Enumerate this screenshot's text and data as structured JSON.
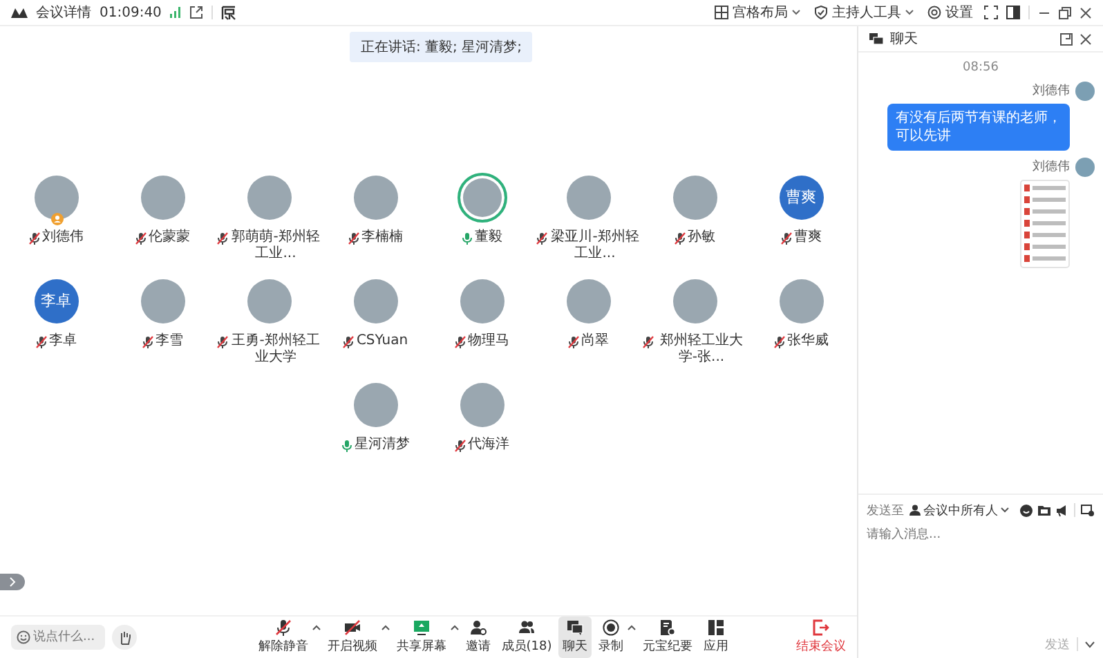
{
  "top_bar": {
    "title": "会议详情",
    "duration": "01:09:40",
    "menus": [
      {
        "label": "宫格布局",
        "kind": "grid"
      },
      {
        "label": "主持人工具",
        "kind": "host"
      },
      {
        "label": "设置",
        "kind": "settings"
      }
    ]
  },
  "speaking_banner": "正在讲话: 董毅; 星河清梦;",
  "participants": [
    {
      "name": "刘德伟",
      "kind": "photo",
      "muted": true,
      "host": true,
      "speaking": false
    },
    {
      "name": "伦蒙蒙",
      "kind": "photo",
      "muted": true,
      "host": false,
      "speaking": false
    },
    {
      "name": "郭萌萌-郑州轻工业...",
      "kind": "photo",
      "muted": true,
      "host": false,
      "speaking": false
    },
    {
      "name": "李楠楠",
      "kind": "photo",
      "muted": true,
      "host": false,
      "speaking": false
    },
    {
      "name": "董毅",
      "kind": "photo",
      "muted": false,
      "host": false,
      "speaking": true
    },
    {
      "name": "梁亚川-郑州轻工业...",
      "kind": "photo",
      "muted": true,
      "host": false,
      "speaking": false
    },
    {
      "name": "孙敏",
      "kind": "photo",
      "muted": true,
      "host": false,
      "speaking": false
    },
    {
      "name": "曹爽",
      "kind": "text",
      "avatar_text": "曹爽",
      "muted": true,
      "host": false,
      "speaking": false
    },
    {
      "name": "李卓",
      "kind": "text",
      "avatar_text": "李卓",
      "muted": true,
      "host": false,
      "speaking": false
    },
    {
      "name": "李雪",
      "kind": "photo",
      "muted": true,
      "host": false,
      "speaking": false
    },
    {
      "name": "王勇-郑州轻工业大学",
      "kind": "photo",
      "muted": true,
      "host": false,
      "speaking": false
    },
    {
      "name": "CSYuan",
      "kind": "photo",
      "muted": true,
      "host": false,
      "speaking": false
    },
    {
      "name": "物理马",
      "kind": "photo",
      "muted": true,
      "host": false,
      "speaking": false
    },
    {
      "name": "尚翠",
      "kind": "photo",
      "muted": true,
      "host": false,
      "speaking": false
    },
    {
      "name": "郑州轻工业大学-张...",
      "kind": "photo",
      "muted": true,
      "host": false,
      "speaking": false
    },
    {
      "name": "张华威",
      "kind": "photo",
      "muted": true,
      "host": false,
      "speaking": false
    },
    {
      "name": "星河清梦",
      "kind": "photo",
      "muted": false,
      "host": false,
      "speaking": false
    },
    {
      "name": "代海洋",
      "kind": "photo",
      "muted": true,
      "host": false,
      "speaking": false
    }
  ],
  "comment_placeholder": "说点什么...",
  "toolbar": [
    {
      "label": "解除静音",
      "kind": "mic",
      "has_menu": true,
      "selected": false
    },
    {
      "label": "开启视频",
      "kind": "video",
      "has_menu": true,
      "selected": false
    },
    {
      "label": "共享屏幕",
      "kind": "share",
      "has_menu": true,
      "selected": false
    },
    {
      "label": "邀请",
      "kind": "invite",
      "has_menu": false,
      "selected": false
    },
    {
      "label": "成员(18)",
      "kind": "members",
      "has_menu": false,
      "selected": false
    },
    {
      "label": "聊天",
      "kind": "chat",
      "has_menu": false,
      "selected": true
    },
    {
      "label": "录制",
      "kind": "record",
      "has_menu": true,
      "selected": false
    },
    {
      "label": "元宝纪要",
      "kind": "notes",
      "has_menu": false,
      "selected": false
    },
    {
      "label": "应用",
      "kind": "apps",
      "has_menu": false,
      "selected": false
    }
  ],
  "end_button": "结束会议",
  "chat": {
    "title": "聊天",
    "messages": [
      {
        "kind": "time",
        "text": "08:56"
      },
      {
        "kind": "text",
        "sender": "刘德伟",
        "text": "有没有后两节有课的老师，可以先讲"
      },
      {
        "kind": "files",
        "sender": "刘德伟"
      }
    ],
    "send_to_label": "发送至",
    "recipient": "会议中所有人",
    "placeholder": "请输入消息...",
    "send_button": "发送",
    "send_disabled": true
  }
}
